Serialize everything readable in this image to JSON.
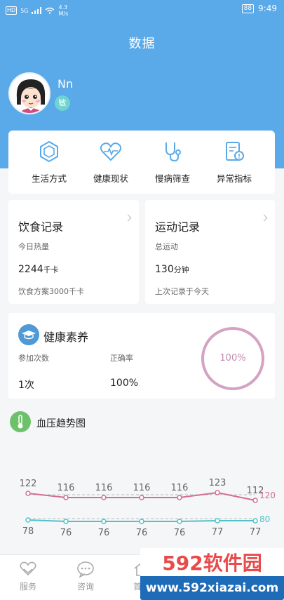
{
  "status_bar": {
    "hd": "HD",
    "signal": "5G",
    "speed": "4.3 M/s",
    "battery": "88",
    "time": "9:49"
  },
  "header": {
    "title": "数据"
  },
  "user": {
    "name": "Nn",
    "badge": "敏"
  },
  "menu": [
    {
      "label": "生活方式",
      "icon": "hexagon-icon"
    },
    {
      "label": "健康现状",
      "icon": "heartbeat-icon"
    },
    {
      "label": "慢病筛查",
      "icon": "stethoscope-icon"
    },
    {
      "label": "异常指标",
      "icon": "alert-document-icon"
    }
  ],
  "diet": {
    "title": "饮食记录",
    "sub": "今日热量",
    "value": "2244",
    "unit": "千卡",
    "foot": "饮食方案3000千卡"
  },
  "exercise": {
    "title": "运动记录",
    "sub": "总运动",
    "value": "130",
    "unit": "分钟",
    "foot": "上次记录于今天"
  },
  "literacy": {
    "title": "健康素养",
    "count_label": "参加次数",
    "rate_label": "正确率",
    "count_value": "1次",
    "rate_value": "100%",
    "ring_value": "100%",
    "ring_percent": 100
  },
  "bp": {
    "title": "血压趋势图"
  },
  "chart_data": {
    "type": "line",
    "series": [
      {
        "values": [
          122,
          116,
          116,
          116,
          116,
          123,
          112
        ],
        "color": "#d36f8f"
      },
      {
        "values": [
          78,
          76,
          76,
          76,
          76,
          77,
          77
        ],
        "color": "#4fc3c9"
      }
    ],
    "reference_lines": [
      {
        "value": 120,
        "label": "120",
        "color": "#d36f8f"
      },
      {
        "value": 80,
        "label": "80",
        "color": "#4fc3c9"
      }
    ]
  },
  "tabs": [
    {
      "label": "服务",
      "icon": "heart-hands-icon"
    },
    {
      "label": "咨询",
      "icon": "chat-bubble-icon"
    },
    {
      "label": "首页",
      "icon": "home-icon"
    }
  ],
  "watermark": {
    "logo": "592软件园",
    "url": "www.592xiazai.com"
  },
  "colors": {
    "primary": "#5aa9e8",
    "systolic": "#d36f8f",
    "diastolic": "#4fc3c9"
  }
}
